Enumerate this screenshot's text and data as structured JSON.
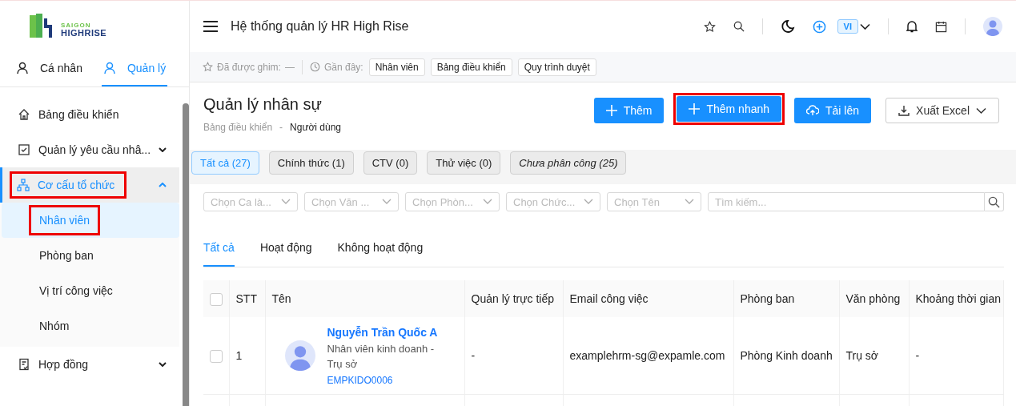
{
  "logo": {
    "line1": "SAIGON",
    "line2": "HIGHRISE"
  },
  "sidebar": {
    "tabs": [
      {
        "label": "Cá nhân",
        "selected": false
      },
      {
        "label": "Quản lý",
        "selected": true
      }
    ],
    "items": [
      {
        "label": "Bảng điều khiển",
        "kind": "home",
        "selected": false,
        "highlighted": false
      },
      {
        "label": "Quản lý yêu cầu nhâ...",
        "kind": "check",
        "expanded": false,
        "selected": false,
        "highlighted": false
      },
      {
        "label": "Cơ cấu tổ chức",
        "kind": "org",
        "expanded": true,
        "selected": true,
        "highlighted": true,
        "children": [
          {
            "label": "Nhân viên",
            "selected": true,
            "highlighted": true
          },
          {
            "label": "Phòng ban",
            "selected": false,
            "highlighted": false
          },
          {
            "label": "Vị trí công việc",
            "selected": false,
            "highlighted": false
          },
          {
            "label": "Nhóm",
            "selected": false,
            "highlighted": false
          }
        ]
      },
      {
        "label": "Hợp đồng",
        "kind": "contract",
        "expanded": false,
        "selected": false,
        "highlighted": false
      }
    ]
  },
  "header": {
    "title": "Hệ thống quản lý HR High Rise",
    "language": "VI"
  },
  "pinned": {
    "label": "Đã được ghim:",
    "value": "—",
    "recent_label": "Gần đây:",
    "recent": [
      "Nhân viên",
      "Bảng điều khiển",
      "Quy trình duyệt"
    ]
  },
  "page": {
    "title": "Quản lý nhân sự",
    "breadcrumb": [
      "Bảng điều khiển",
      "-",
      "Người dùng"
    ],
    "actions": [
      {
        "label": "Thêm",
        "kind": "add",
        "highlighted": false
      },
      {
        "label": "Thêm nhanh",
        "kind": "add",
        "highlighted": true
      },
      {
        "label": "Tải lên",
        "kind": "upload",
        "highlighted": false
      },
      {
        "label": "Xuất Excel",
        "kind": "export",
        "highlighted": false
      }
    ]
  },
  "status_tabs": [
    {
      "label": "Tất cả (27)",
      "selected": true,
      "italic": false
    },
    {
      "label": "Chính thức (1)",
      "selected": false,
      "italic": false
    },
    {
      "label": "CTV (0)",
      "selected": false,
      "italic": false
    },
    {
      "label": "Thử việc (0)",
      "selected": false,
      "italic": false
    },
    {
      "label": "Chưa phân công (25)",
      "selected": false,
      "italic": true
    }
  ],
  "filters": [
    {
      "placeholder": "Chọn Ca là..."
    },
    {
      "placeholder": "Chọn Văn ..."
    },
    {
      "placeholder": "Chọn Phòn..."
    },
    {
      "placeholder": "Chọn Chức..."
    },
    {
      "placeholder": "Chọn Tên"
    }
  ],
  "search": {
    "placeholder": "Tìm kiếm..."
  },
  "tabs": [
    {
      "label": "Tất cả",
      "selected": true
    },
    {
      "label": "Hoạt động",
      "selected": false
    },
    {
      "label": "Không hoạt động",
      "selected": false
    }
  ],
  "table": {
    "all_checked": false,
    "columns": [
      "STT",
      "Tên",
      "Quản lý trực tiếp",
      "Email công việc",
      "Phòng ban",
      "Văn phòng",
      "Khoảng thời gian"
    ],
    "rows": [
      {
        "checked": false,
        "stt": "1",
        "name": "Nguyễn Trần Quốc A",
        "position": "Nhân viên kinh doanh - Trụ sở",
        "code": "EMPKIDO0006",
        "manager": "-",
        "email": "examplehrm-sg@expamle.com",
        "department": "Phòng Kinh doanh",
        "office": "Trụ sở",
        "period": "-"
      }
    ]
  }
}
